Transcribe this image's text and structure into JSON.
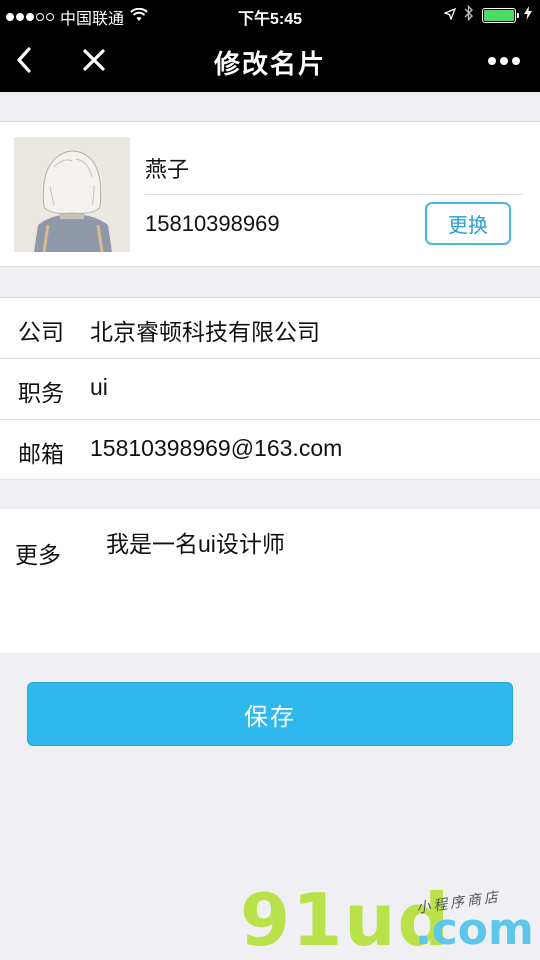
{
  "status_bar": {
    "carrier": "中国联通",
    "time": "下午5:45",
    "signal_bars_filled": 3,
    "signal_bars_total": 5,
    "battery_level": 1.0,
    "icons": [
      "wifi-icon",
      "location-arrow-icon",
      "bluetooth-icon",
      "battery-icon",
      "charging-icon"
    ]
  },
  "nav": {
    "title": "修改名片",
    "back_icon": "chevron-left-icon",
    "close_icon": "close-icon",
    "more_icon": "more-dots-icon"
  },
  "profile": {
    "name": "燕子",
    "phone": "15810398969",
    "change_label": "更换"
  },
  "info": {
    "rows": [
      {
        "label": "公司",
        "value": "北京睿顿科技有限公司"
      },
      {
        "label": "职务",
        "value": "ui"
      },
      {
        "label": "邮箱",
        "value": "15810398969@163.com"
      }
    ]
  },
  "more": {
    "label": "更多",
    "value": "我是一名ui设计师"
  },
  "save_label": "保存",
  "watermark": {
    "brand": "91ud",
    "domain": ".com",
    "tagline": "小程序商店"
  },
  "colors": {
    "accent": "#2fb8ec",
    "background": "#efeff4",
    "bar": "#000000"
  }
}
